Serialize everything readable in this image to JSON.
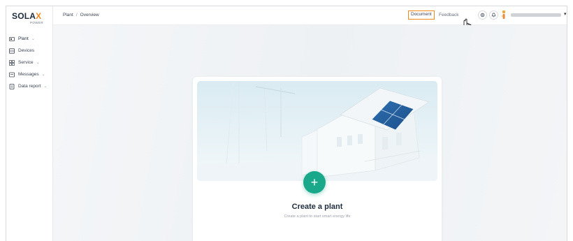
{
  "logo": {
    "main": "SOLA",
    "x": "X",
    "sub": "POWER"
  },
  "sidebar": {
    "items": [
      {
        "label": "Plant",
        "icon": "plant-icon",
        "has_chevron": true
      },
      {
        "label": "Devices",
        "icon": "devices-icon",
        "has_chevron": false
      },
      {
        "label": "Service",
        "icon": "service-icon",
        "has_chevron": true
      },
      {
        "label": "Messages",
        "icon": "messages-icon",
        "has_chevron": true
      },
      {
        "label": "Data report",
        "icon": "data-report-icon",
        "has_chevron": true
      }
    ],
    "chevron": "⌄"
  },
  "header": {
    "breadcrumb": {
      "root": "Plant",
      "separator": "/",
      "current": "Overview"
    },
    "document_label": "Document",
    "feedback_label": "Feedback",
    "user_caret": "▾"
  },
  "card": {
    "add_symbol": "+",
    "title": "Create a plant",
    "subtitle": "Create a plant to start smart energy life"
  },
  "colors": {
    "accent": "#1aa88a",
    "brand_orange": "#f08a1c",
    "highlight_border": "#f08a1c"
  }
}
